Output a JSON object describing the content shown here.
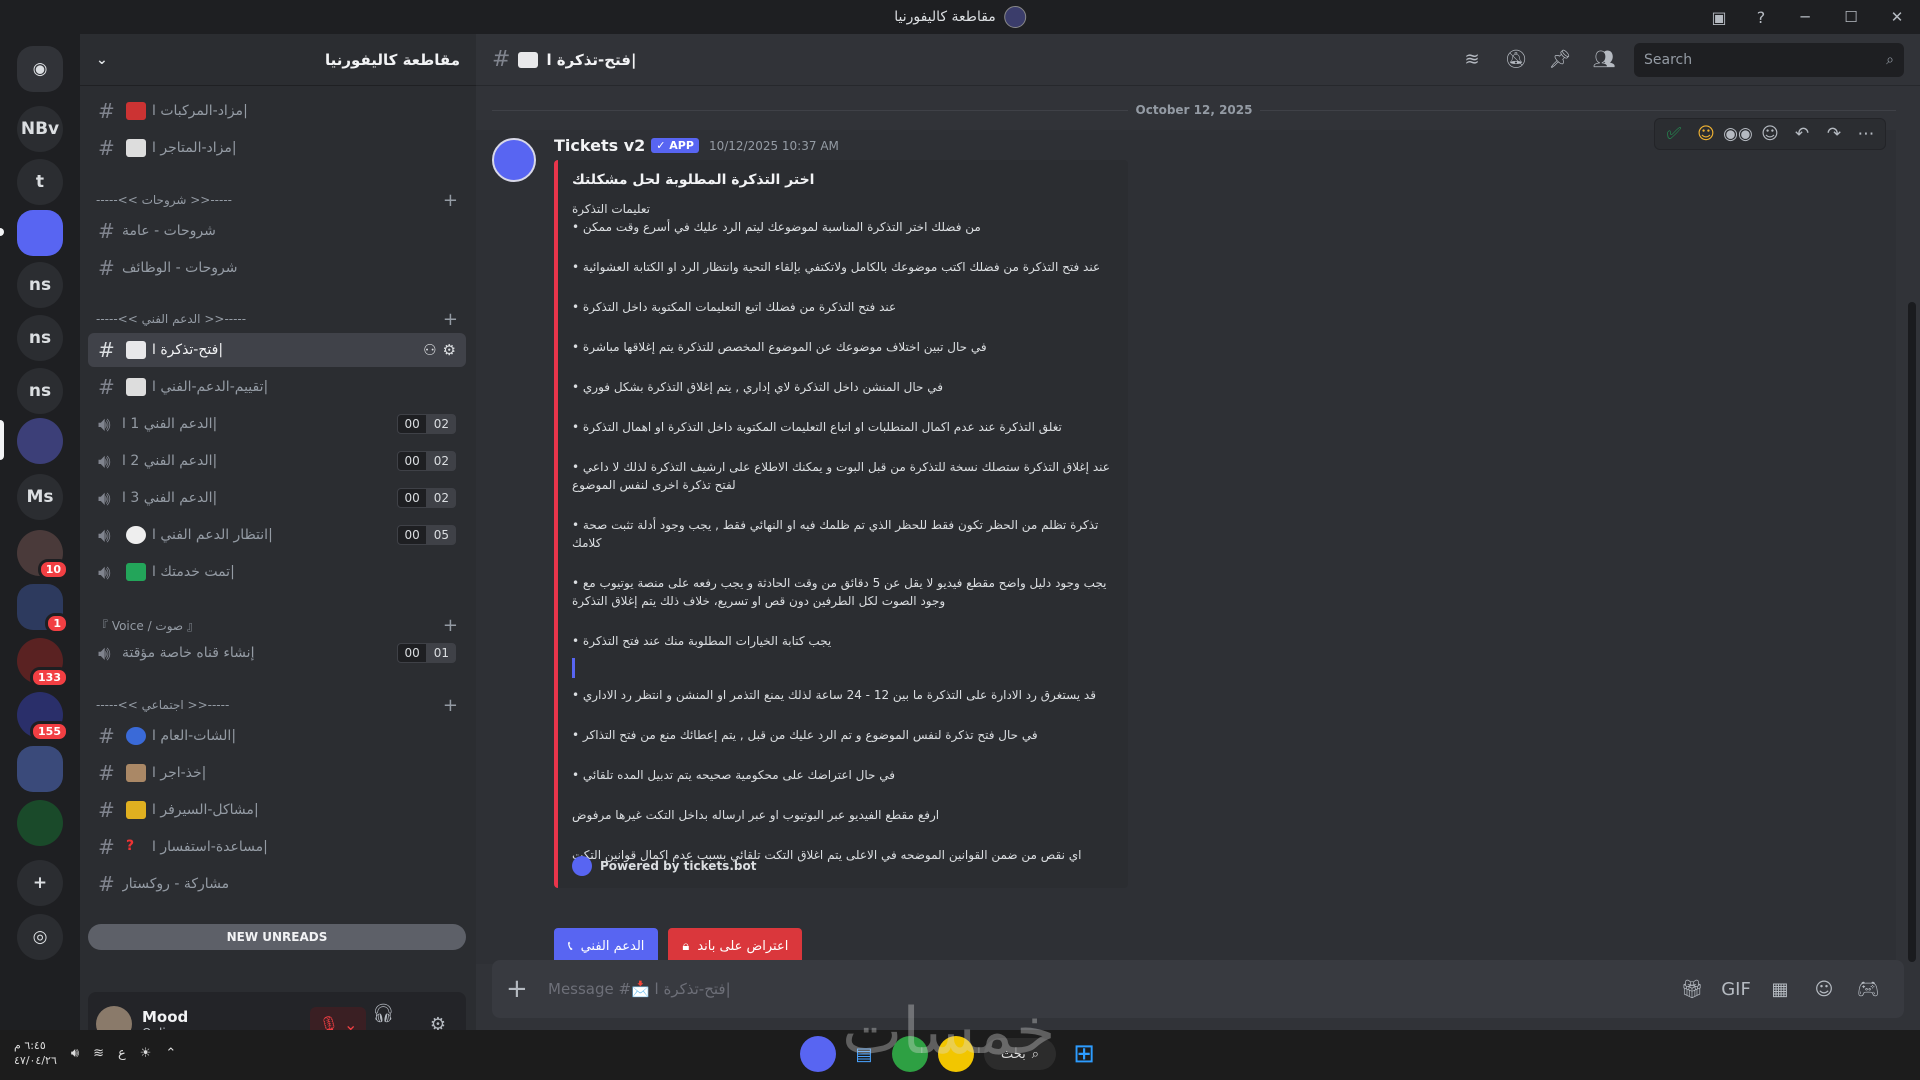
{
  "window": {
    "title": "مقاطعة كاليفورنيا"
  },
  "rail": {
    "items": [
      {
        "label": "NBv"
      },
      {
        "label": "t"
      },
      {
        "label": "ns"
      },
      {
        "label": "ns"
      },
      {
        "label": "ns"
      },
      {
        "label": "Ms"
      }
    ],
    "badges": [
      "10",
      "1",
      "133",
      "155"
    ]
  },
  "guild": {
    "name": "مقاطعة كاليفورنيا"
  },
  "channels": [
    {
      "name": "مزاد-المركبات ا|",
      "kind": "text"
    },
    {
      "name": "مزاد-المتاجر ا|",
      "kind": "text"
    },
    {
      "name": "شروحات - عامة",
      "kind": "text"
    },
    {
      "name": "شروحات - الوظائف",
      "kind": "text"
    },
    {
      "name": "فتح-تذكرة ا|",
      "kind": "text"
    },
    {
      "name": "تقييم-الدعم-الفني ا|",
      "kind": "text"
    },
    {
      "name": "الدعم الفني 1 ا|",
      "kind": "voice",
      "c1": "00",
      "c2": "02"
    },
    {
      "name": "الدعم الفني 2 ا|",
      "kind": "voice",
      "c1": "00",
      "c2": "02"
    },
    {
      "name": "الدعم الفني 3 ا|",
      "kind": "voice",
      "c1": "00",
      "c2": "02"
    },
    {
      "name": "انتظار الدعم الفني ا|",
      "kind": "voice",
      "c1": "00",
      "c2": "05"
    },
    {
      "name": "تمت خدمتك ا|",
      "kind": "voice"
    },
    {
      "name": "إنشاء قناه خاصة مؤقتة",
      "kind": "voice",
      "c1": "00",
      "c2": "01"
    },
    {
      "name": "الشات-العام ا|",
      "kind": "text"
    },
    {
      "name": "خذ-اجر ا|",
      "kind": "text"
    },
    {
      "name": "مشاكل-السيرفر ا|",
      "kind": "text"
    },
    {
      "name": "مساعدة-استفسار ا|",
      "kind": "text"
    },
    {
      "name": "مشاركة - روكستار",
      "kind": "text"
    }
  ],
  "categories": [
    {
      "name": "-----<< شروحات >>-----"
    },
    {
      "name": "-----<< الدعم الفني >>-----"
    },
    {
      "name": "『 Voice / صوت 』"
    },
    {
      "name": "-----<< اجتماعي >>-----"
    }
  ],
  "new_unreads": "NEW UNREADS",
  "user": {
    "name": "Mood",
    "status": "Online"
  },
  "topbar": {
    "channel": "فتح-تذكرة ا|",
    "search_placeholder": "Search"
  },
  "date_divider": "October 12, 2025",
  "message": {
    "author": "Tickets v2",
    "tag": "APP",
    "timestamp": "10/12/2025 10:37 AM",
    "embed": {
      "title": "اختر التذكرة المطلوبة لحل مشكلتك",
      "subtitle": "تعليمات التذكرة",
      "lines": [
        "• من فضلك اختر التذكرة المناسبة لموضوعك ليتم الرد عليك في أسرع وقت ممكن",
        "• عند فتح التذكرة من فضلك اكتب موضوعك بالكامل ولاتكتفي بإلقاء التحية وانتظار الرد او الكتابة العشوائية",
        "• عند فتح التذكرة من فضلك اتبع التعليمات المكتوبة داخل التذكرة",
        "• في حال تبين اختلاف موضوعك عن الموضوع المخصص للتذكرة يتم إغلاقها مباشرة",
        "• في حال المنشن داخل التذكرة لاي إداري , يتم إغلاق التذكرة بشكل فوري",
        "• تغلق التذكرة عند عدم اكمال المتطلبات او اتباع التعليمات المكتوبة داخل التذكرة او اهمال التذكرة",
        "• عند إغلاق التذكرة ستصلك نسخة للتذكرة من قبل البوت و يمكنك الاطلاع على ارشيف التذكرة لذلك لا داعي لفتح تذكرة اخرى لنفس الموضوع",
        "• تذكرة تظلم من الحظر تكون فقط للحظر الذي تم ظلمك فيه او النهائي فقط , يجب وجود أدلة تثبت صحة كلامك",
        "• يجب وجود دليل واضح مقطع فيديو لا يقل عن 5 دقائق من وقت الحادثة و يجب رفعه على منصة يوتيوب مع وجود الصوت لكل الطرفين دون قص او تسريع، خلاف ذلك يتم إغلاق التذكرة",
        "• يجب كتابة الخيارات المطلوبة منك عند فتح التذكرة",
        "• قد يستغرق رد الادارة على التذكرة ما بين 12 - 24 ساعة لذلك يمنع التذمر او المنشن و انتظر رد الاداري",
        "• في حال فتح تذكرة لنفس الموضوع و تم الرد عليك من قبل , يتم إعطائك منع من فتح التذاكر",
        "• في حال اعتراضك على محكومية صحيحه يتم تدبيل المده تلقائي",
        "ارفع مقطع الفيديو عبر اليوتيوب او عبر ارساله بداخل التكت غيرها مرفوض",
        "اي نقص من ضمن القوانين الموضحه في الاعلى يتم اغلاق التكت تلقائي بسبب عدم اكمال قوانين التكت"
      ],
      "footer": "Powered by tickets.bot"
    },
    "buttons": [
      {
        "label": "الدعم الفني",
        "color": "#5865f2"
      },
      {
        "label": "اعتراض على باند",
        "color": "#da373c"
      }
    ]
  },
  "composer": {
    "placeholder": "Message #📩 فتح-تذكرة ا|"
  },
  "taskbar": {
    "clock_time": "٦:٤٥ م",
    "clock_date": "٤٧/٠٤/٢٦",
    "lang": "ع",
    "search": "بحث",
    "watermark": "خمسات"
  },
  "colors": {
    "accent": "#5865f2",
    "embed_bar": "#e9354b",
    "danger": "#da373c",
    "online": "#23a55a"
  }
}
